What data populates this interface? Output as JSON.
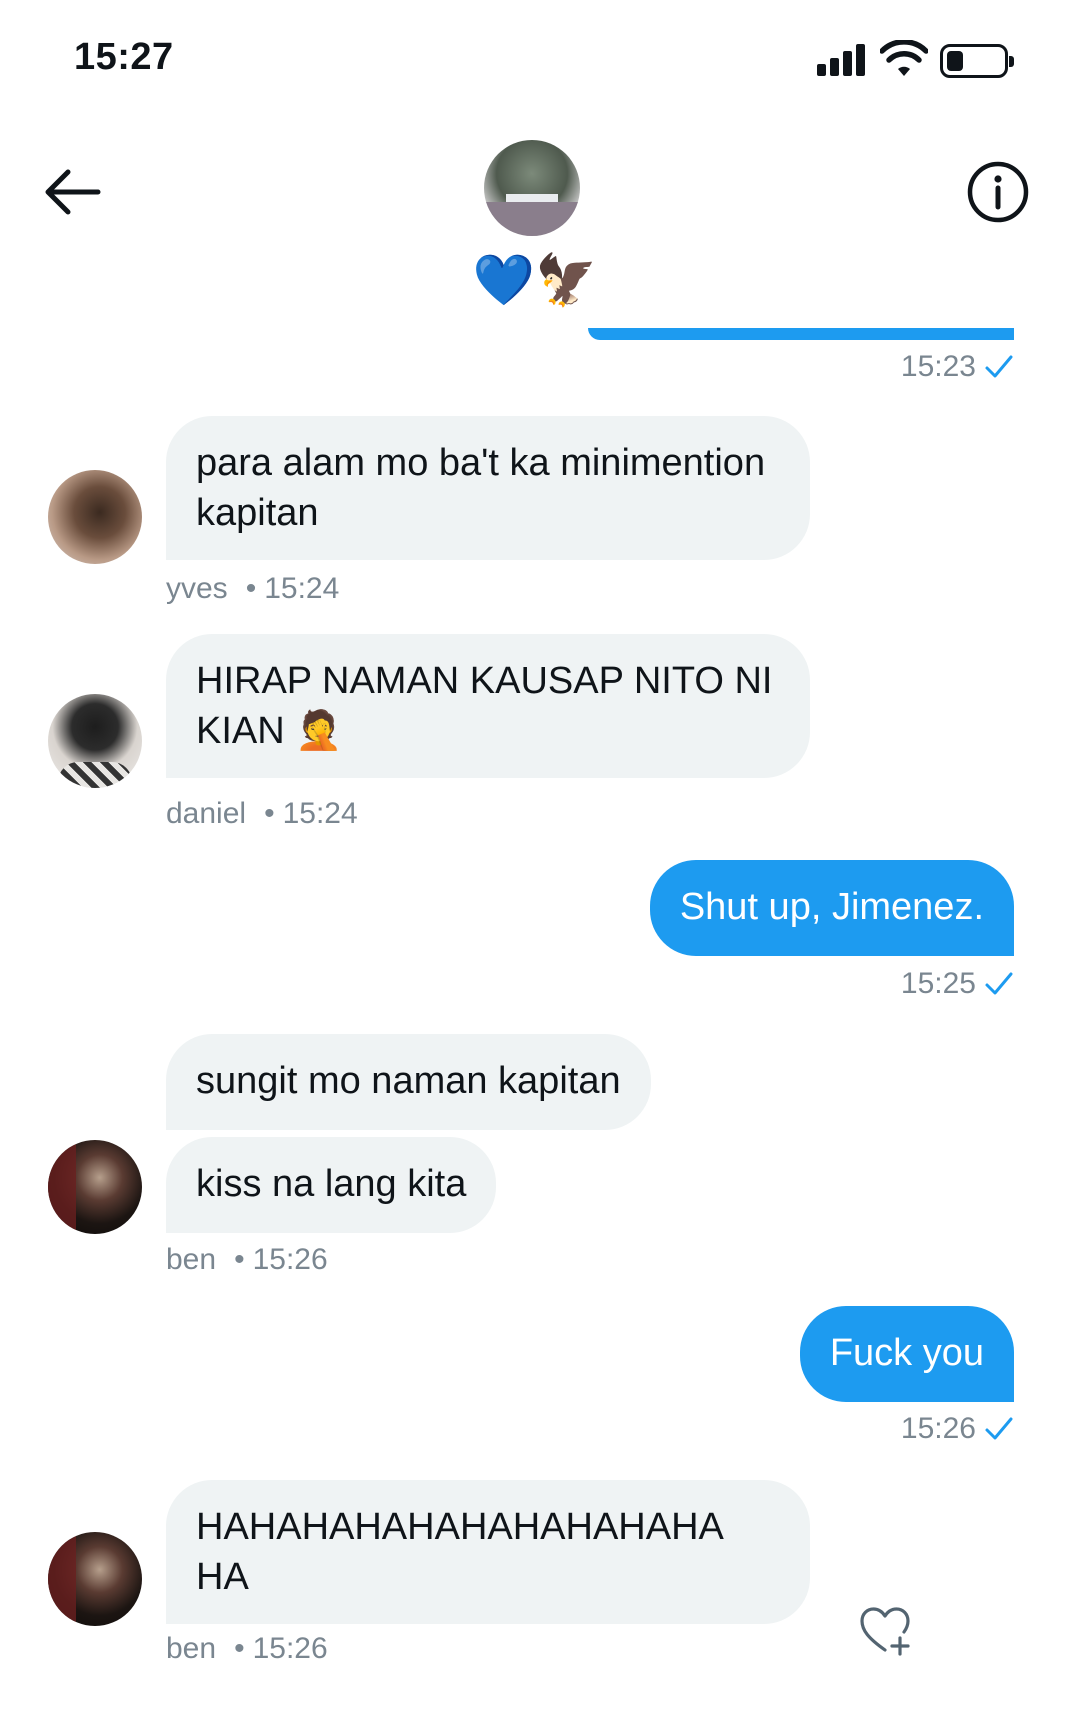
{
  "status_bar": {
    "time": "15:27",
    "battery_level": 0.3
  },
  "header": {
    "back_icon": "arrow-left-icon",
    "info_icon": "info-circle-icon",
    "group_name": "💙🦅"
  },
  "colors": {
    "accent": "#1d9bf0",
    "incoming_bubble": "#eff3f4",
    "meta_text": "#7a8690"
  },
  "top_remnant": {
    "time": "15:23"
  },
  "messages": [
    {
      "id": "m1",
      "direction": "in",
      "sender": "yves",
      "text": "para alam mo ba't ka minimention kapitan",
      "time": "15:24"
    },
    {
      "id": "m2",
      "direction": "in",
      "sender": "daniel",
      "text": "HIRAP NAMAN KAUSAP NITO NI KIAN 🤦",
      "time": "15:24"
    },
    {
      "id": "m3",
      "direction": "out",
      "text": "Shut up, Jimenez.",
      "time": "15:25"
    },
    {
      "id": "m4a",
      "direction": "in",
      "sender": "ben",
      "text": "sungit mo naman kapitan"
    },
    {
      "id": "m4b",
      "direction": "in",
      "sender": "ben",
      "text": "kiss na lang kita",
      "time": "15:26"
    },
    {
      "id": "m5",
      "direction": "out",
      "text": "Fuck you",
      "time": "15:26"
    },
    {
      "id": "m6",
      "direction": "in",
      "sender": "ben",
      "text": "HAHAHAHAHAHAHAHAHAHA HA",
      "time": "15:26"
    }
  ],
  "meta_separator": "•",
  "react_icon": "heart-add-icon"
}
